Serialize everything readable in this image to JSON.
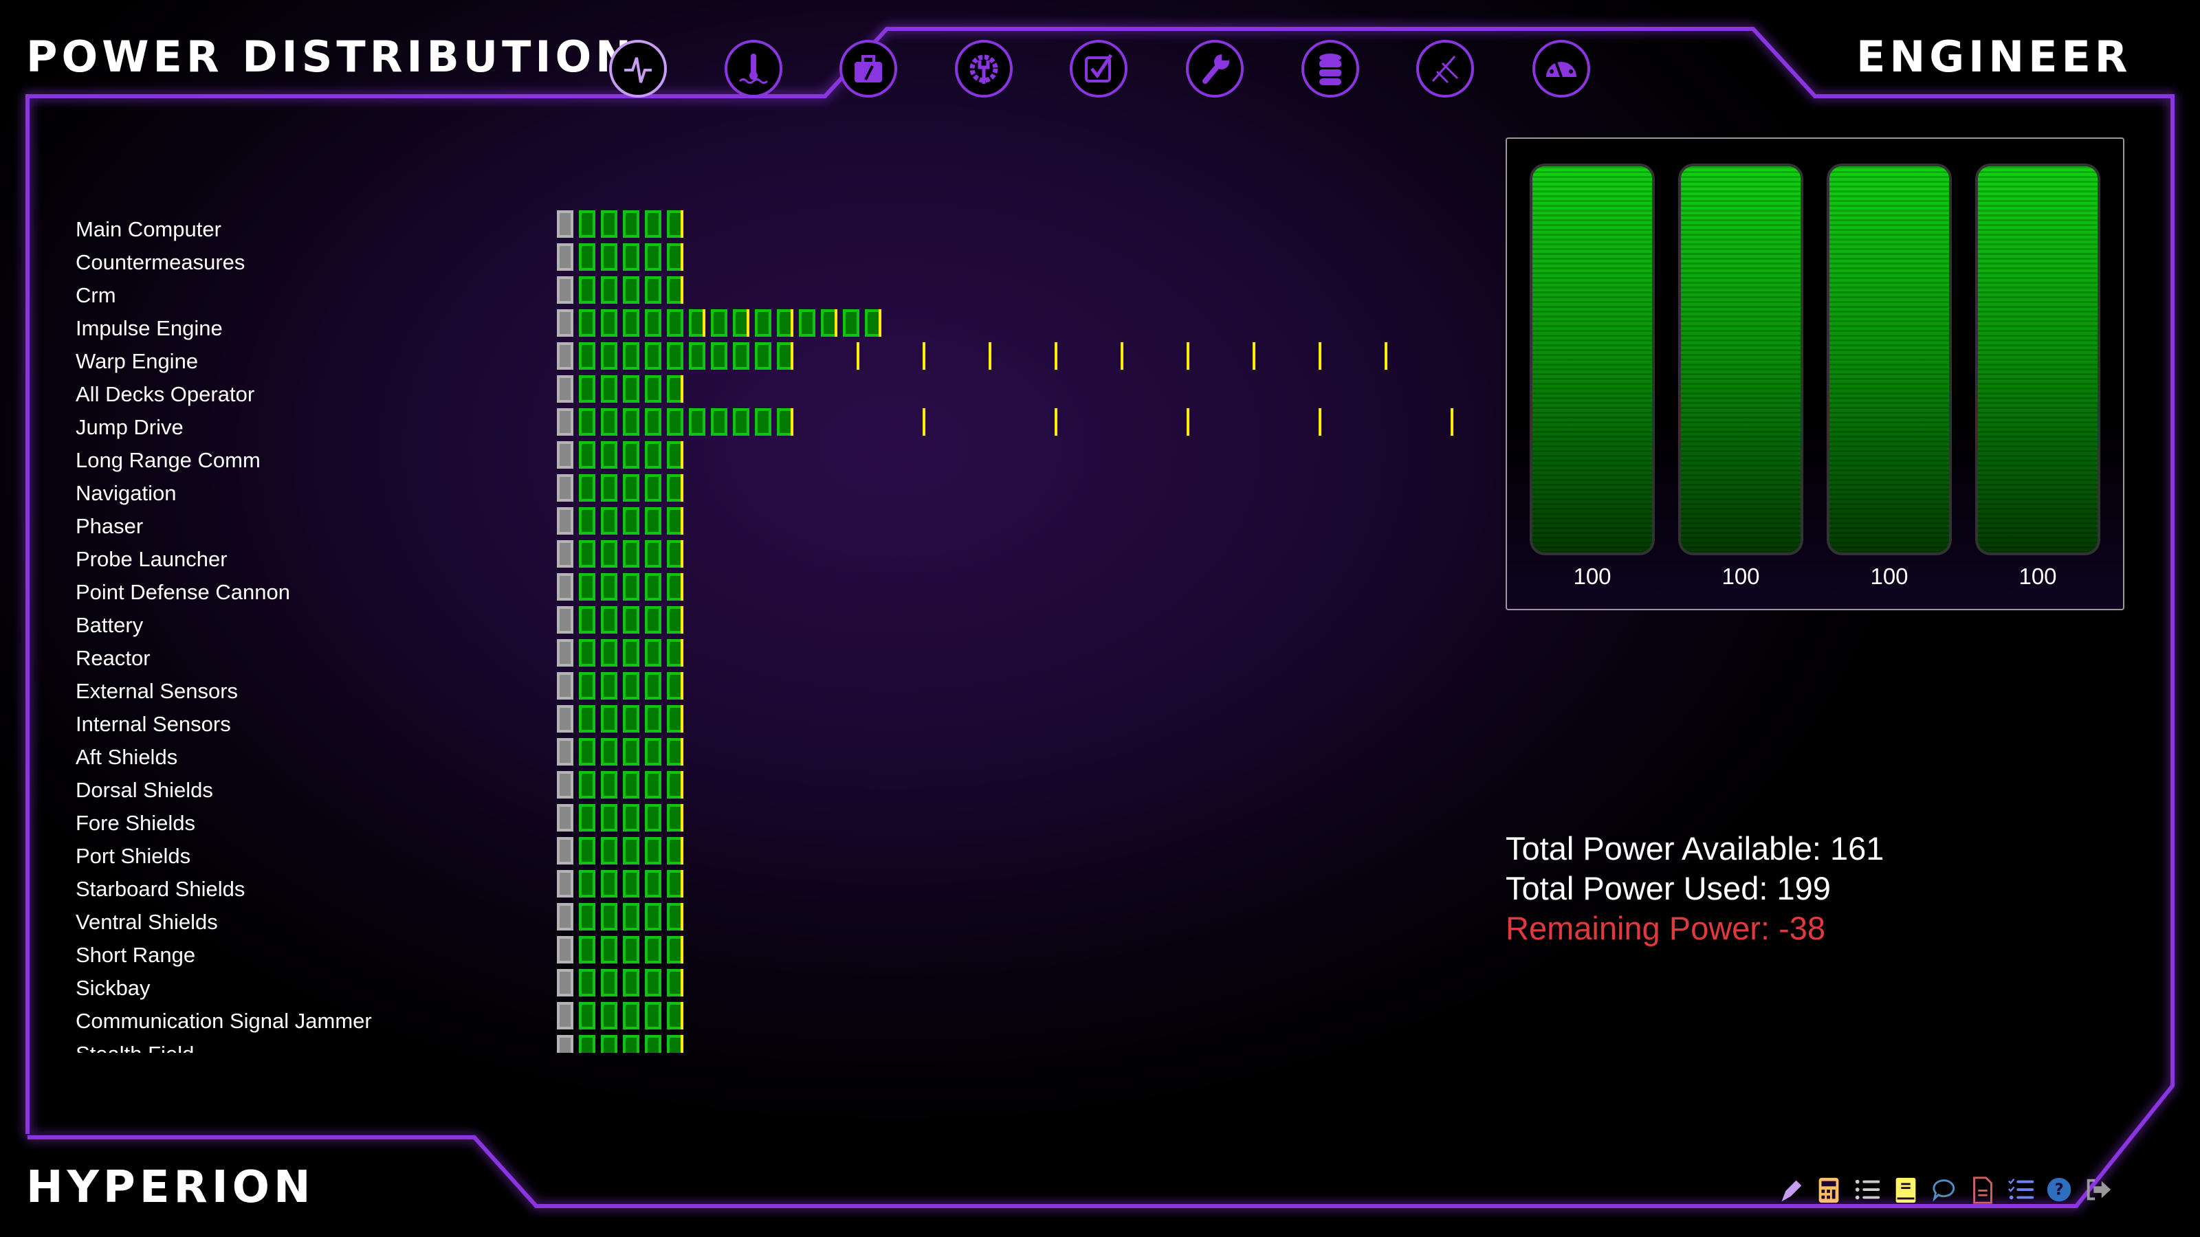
{
  "header": {
    "title": "POWER DISTRIBUTION",
    "role": "ENGINEER"
  },
  "footer": {
    "ship_name": "HYPERION"
  },
  "nav_icons": [
    {
      "name": "power-pulse-icon",
      "active": true
    },
    {
      "name": "thermometer-coolant-icon"
    },
    {
      "name": "toolbox-icon"
    },
    {
      "name": "gear-wrench-icon"
    },
    {
      "name": "checkbox-icon"
    },
    {
      "name": "wrench-icon"
    },
    {
      "name": "database-icon"
    },
    {
      "name": "tools-icon"
    },
    {
      "name": "dashboard-gauge-icon"
    }
  ],
  "systems": [
    {
      "name": "Main Computer",
      "power": 5,
      "markers": [
        5
      ]
    },
    {
      "name": "Countermeasures",
      "power": 5,
      "markers": [
        5
      ]
    },
    {
      "name": "Crm",
      "power": 5,
      "markers": [
        5
      ]
    },
    {
      "name": "Impulse Engine",
      "power": 14,
      "markers": [
        6,
        8,
        10,
        12,
        14
      ]
    },
    {
      "name": "Warp Engine",
      "power": 10,
      "markers": [
        10,
        13,
        16,
        19,
        22,
        25,
        28,
        31,
        34,
        37
      ]
    },
    {
      "name": "All Decks Operator",
      "power": 5,
      "markers": [
        5
      ]
    },
    {
      "name": "Jump Drive",
      "power": 10,
      "markers": [
        10,
        16,
        22,
        28,
        34,
        40
      ]
    },
    {
      "name": "Long Range Comm",
      "power": 5,
      "markers": [
        5
      ]
    },
    {
      "name": "Navigation",
      "power": 5,
      "markers": [
        5
      ]
    },
    {
      "name": "Phaser",
      "power": 5,
      "markers": [
        5
      ]
    },
    {
      "name": "Probe Launcher",
      "power": 5,
      "markers": [
        5
      ]
    },
    {
      "name": "Point Defense Cannon",
      "power": 5,
      "markers": [
        5
      ]
    },
    {
      "name": "Battery",
      "power": 5,
      "markers": [
        5
      ]
    },
    {
      "name": "Reactor",
      "power": 5,
      "markers": [
        5
      ]
    },
    {
      "name": "External Sensors",
      "power": 5,
      "markers": [
        5
      ]
    },
    {
      "name": "Internal Sensors",
      "power": 5,
      "markers": [
        5
      ]
    },
    {
      "name": "Aft Shields",
      "power": 5,
      "markers": [
        5
      ]
    },
    {
      "name": "Dorsal Shields",
      "power": 5,
      "markers": [
        5
      ]
    },
    {
      "name": "Fore Shields",
      "power": 5,
      "markers": [
        5
      ]
    },
    {
      "name": "Port Shields",
      "power": 5,
      "markers": [
        5
      ]
    },
    {
      "name": "Starboard Shields",
      "power": 5,
      "markers": [
        5
      ]
    },
    {
      "name": "Ventral Shields",
      "power": 5,
      "markers": [
        5
      ]
    },
    {
      "name": "Short Range",
      "power": 5,
      "markers": [
        5
      ]
    },
    {
      "name": "Sickbay",
      "power": 5,
      "markers": [
        5
      ]
    },
    {
      "name": "Communication Signal Jammer",
      "power": 5,
      "markers": [
        5
      ]
    },
    {
      "name": "Stealth Field",
      "power": 5,
      "markers": [
        5
      ]
    }
  ],
  "reactors": [
    {
      "value": "100",
      "level": 100
    },
    {
      "value": "100",
      "level": 100
    },
    {
      "value": "100",
      "level": 100
    },
    {
      "value": "100",
      "level": 100
    }
  ],
  "stats": {
    "available": "Total Power Available: 161",
    "used": "Total Power Used: 199",
    "remaining": "Remaining Power: -38"
  },
  "colors": {
    "accent": "#8a35e0",
    "cell_on": "#12c412",
    "marker": "#ffee00",
    "negative": "#e0393e"
  },
  "toolbar_icons": [
    {
      "name": "pen-icon",
      "color": "#c79cf5"
    },
    {
      "name": "calculator-icon",
      "color": "#ffbf66"
    },
    {
      "name": "list-icon",
      "color": "#cccccc"
    },
    {
      "name": "book-icon",
      "color": "#fff36a"
    },
    {
      "name": "chat-bubble-icon",
      "color": "#4f8fc4"
    },
    {
      "name": "document-icon",
      "color": "#d26060"
    },
    {
      "name": "checklist-icon",
      "color": "#6c84f0"
    },
    {
      "name": "help-icon",
      "color": "#2f6fc0"
    },
    {
      "name": "logout-icon",
      "color": "#999999"
    }
  ]
}
